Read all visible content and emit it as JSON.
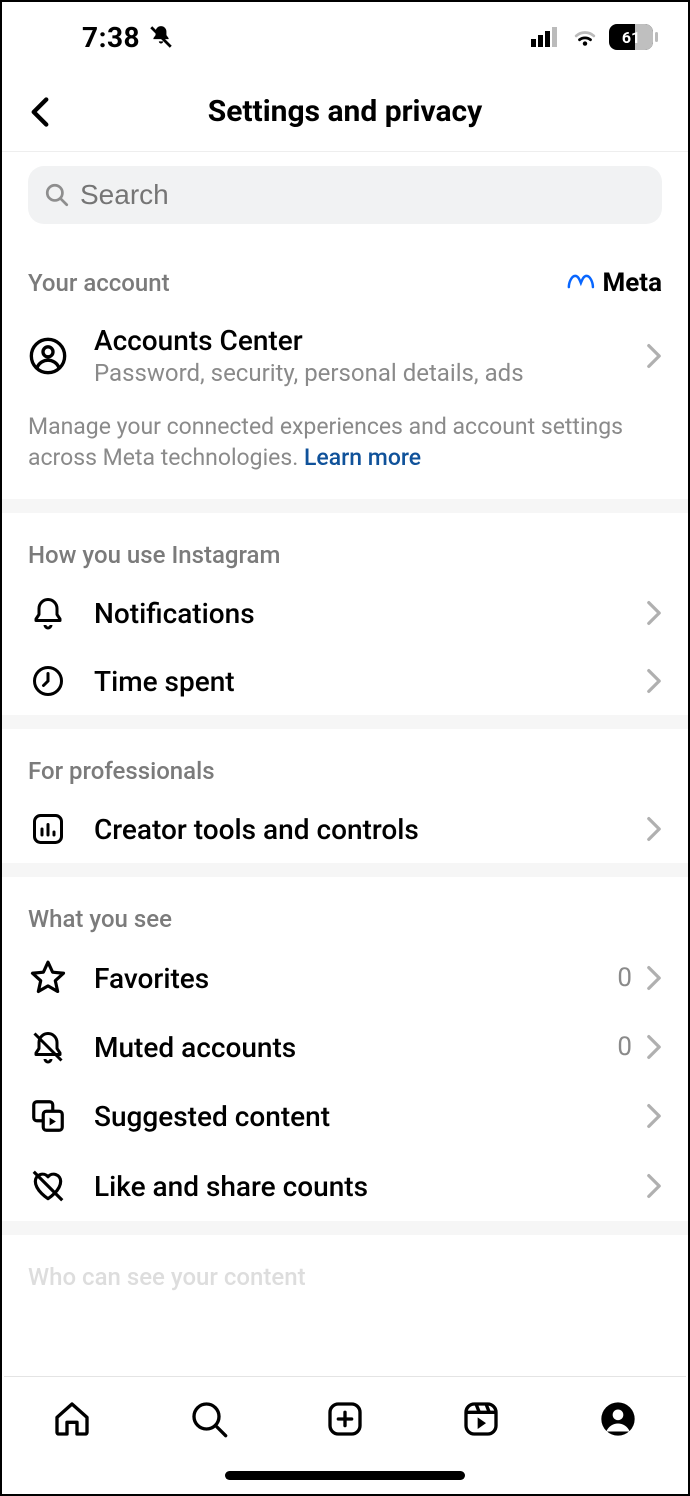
{
  "status": {
    "time": "7:38",
    "battery": "61"
  },
  "header": {
    "title": "Settings and privacy"
  },
  "search": {
    "placeholder": "Search"
  },
  "account": {
    "section": "Your account",
    "brand": "Meta",
    "ac_title": "Accounts Center",
    "ac_sub": "Password, security, personal details, ads",
    "manage": "Manage your connected experiences and account settings across Meta technologies. ",
    "learn": "Learn more"
  },
  "usage": {
    "section": "How you use Instagram",
    "notifications": "Notifications",
    "timespent": "Time spent"
  },
  "pro": {
    "section": "For professionals",
    "creator": "Creator tools and controls"
  },
  "see": {
    "section": "What you see",
    "favorites": "Favorites",
    "favorites_count": "0",
    "muted": "Muted accounts",
    "muted_count": "0",
    "suggested": "Suggested content",
    "likeshare": "Like and share counts"
  },
  "next": {
    "section": "Who can see your content"
  }
}
